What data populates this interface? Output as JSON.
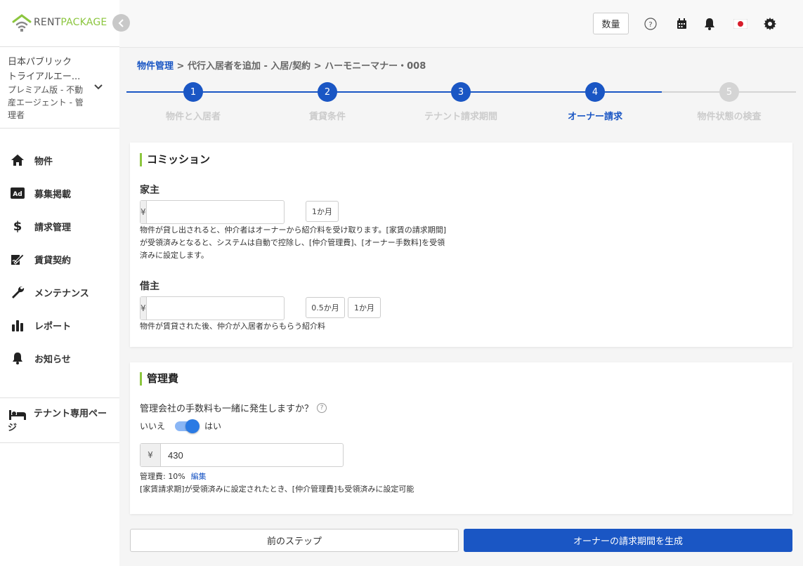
{
  "brand": {
    "rent": "RENT",
    "package": "PACKAGE",
    "green": "#8cc63f"
  },
  "sidebar": {
    "org_line1": "日本パブリック",
    "org_line2": "トライアルエー...",
    "org_line3": "プレミアム版 - 不動産エージェント - 管理者",
    "items": [
      {
        "label": "物件",
        "icon": "home-icon"
      },
      {
        "label": "募集掲載",
        "icon": "ad-icon"
      },
      {
        "label": "請求管理",
        "icon": "dollar-icon"
      },
      {
        "label": "賃貸契約",
        "icon": "contract-icon"
      },
      {
        "label": "メンテナンス",
        "icon": "wrench-icon"
      },
      {
        "label": "レポート",
        "icon": "chart-icon"
      },
      {
        "label": "お知らせ",
        "icon": "bell-icon"
      }
    ],
    "tenant_page": "テナント専用ページ"
  },
  "header": {
    "qty_label": "数量"
  },
  "breadcrumb": {
    "root": "物件管理",
    "sep": " > ",
    "mid": "代行入居者を追加 - 入居/契約",
    "current": "ハーモニーマナー・008"
  },
  "stepper": {
    "steps": [
      {
        "num": "1",
        "label": "物件と入居者",
        "state": "done"
      },
      {
        "num": "2",
        "label": "賃貸条件",
        "state": "done"
      },
      {
        "num": "3",
        "label": "テナント請求期間",
        "state": "done"
      },
      {
        "num": "4",
        "label": "オーナー請求",
        "state": "current"
      },
      {
        "num": "5",
        "label": "物件状態の検査",
        "state": "todo"
      }
    ]
  },
  "commission": {
    "title": "コミッション",
    "landlord_label": "家主",
    "currency": "¥",
    "landlord_value": "",
    "landlord_chip": "1か月",
    "landlord_help": "物件が貸し出されると、仲介者はオーナーから紹介料を受け取ります。[家賃の請求期間]が受領済みとなると、システムは自動で控除し、[仲介管理費]、[オーナー手数料]を受領済みに設定します。",
    "tenant_label": "借主",
    "tenant_value": "",
    "tenant_chip1": "0.5か月",
    "tenant_chip2": "1か月",
    "tenant_help": "物件が賃貸された後、仲介が入居者からもらう紹介料"
  },
  "management": {
    "title": "管理費",
    "question": "管理会社の手数料も一緒に発生しますか？",
    "no": "いいえ",
    "yes": "はい",
    "enabled": true,
    "currency": "¥",
    "value": "430",
    "fee_rate": "管理費: 10%",
    "edit": "編集",
    "note": "[家賃請求期]が受領済みに設定されたとき、[仲介管理費]も受領済みに設定可能"
  },
  "buttons": {
    "prev": "前のステップ",
    "generate": "オーナーの請求期間を生成"
  },
  "colors": {
    "primary": "#1a56c4",
    "accent": "#8cc63f"
  }
}
